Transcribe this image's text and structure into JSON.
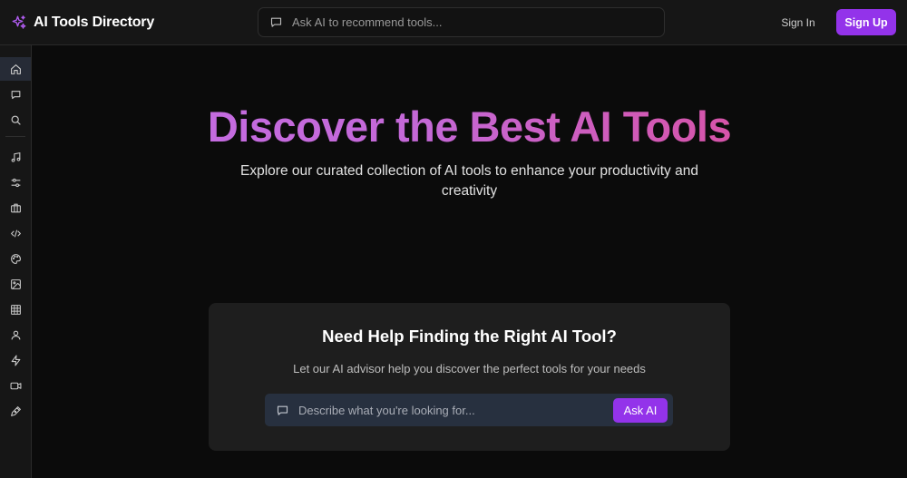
{
  "header": {
    "brand_title": "AI Tools Directory",
    "brand_icon": "sparkles-icon",
    "search": {
      "placeholder": "Ask AI to recommend tools...",
      "value": "",
      "icon": "chat-icon"
    },
    "sign_in_label": "Sign In",
    "sign_up_label": "Sign Up"
  },
  "sidebar": {
    "items": [
      {
        "name": "home",
        "icon": "home-icon",
        "active": true
      },
      {
        "name": "chat",
        "icon": "chat-icon"
      },
      {
        "name": "search",
        "icon": "search-icon"
      },
      {
        "name": "music",
        "icon": "music-icon"
      },
      {
        "name": "settings",
        "icon": "sliders-icon"
      },
      {
        "name": "business",
        "icon": "briefcase-icon"
      },
      {
        "name": "code",
        "icon": "code-icon"
      },
      {
        "name": "design",
        "icon": "palette-icon"
      },
      {
        "name": "image",
        "icon": "image-icon"
      },
      {
        "name": "data",
        "icon": "grid-icon"
      },
      {
        "name": "people",
        "icon": "user-icon"
      },
      {
        "name": "automation",
        "icon": "bolt-icon"
      },
      {
        "name": "video",
        "icon": "video-icon"
      },
      {
        "name": "writing",
        "icon": "pen-icon"
      }
    ]
  },
  "hero": {
    "title": "Discover the Best AI Tools",
    "subtitle": "Explore our curated collection of AI tools to enhance your productivity and creativity"
  },
  "advisor_card": {
    "title": "Need Help Finding the Right AI Tool?",
    "subtitle": "Let our AI advisor help you discover the perfect tools for your needs",
    "input_placeholder": "Describe what you're looking for...",
    "input_value": "",
    "button_label": "Ask AI"
  },
  "colors": {
    "accent": "#9333ea",
    "gradient_start": "#c56ee8",
    "gradient_end": "#e0488f",
    "background": "#0b0b0b",
    "card": "#1e1e1e"
  }
}
